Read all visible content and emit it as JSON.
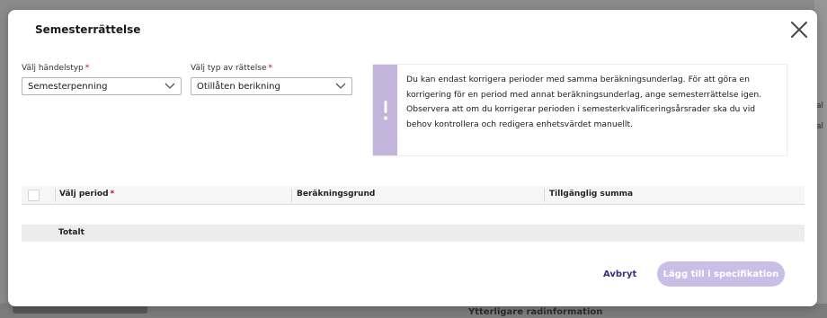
{
  "background": {
    "bottom_text": "Ytterligare radinformation",
    "right_fragments": [
      "al",
      "al"
    ]
  },
  "modal": {
    "title": "Semesterrättelse",
    "close_icon": "close-icon"
  },
  "form": {
    "event_type": {
      "label": "Välj händelstyp",
      "required_mark": "*",
      "value": "Semesterpenning"
    },
    "correction_type": {
      "label": "Välj typ av rättelse",
      "required_mark": "*",
      "value": "Otillåten berikning"
    }
  },
  "info": {
    "icon": "exclamation-icon",
    "accent_color": "#c2b4da",
    "text": "Du kan endast korrigera perioder med samma beräkningsunderlag. För att göra en korrigering för en period med annat beräkningsunderlag, ange semesterrättelse igen. Observera att om du korrigerar perioden i semesterkvalificeringsårsrader ska du vid behov kontrollera och redigera enhetsvärdet manuellt."
  },
  "table": {
    "columns": [
      {
        "label": "Välj period",
        "required_mark": "*"
      },
      {
        "label": "Beräkningsgrund"
      },
      {
        "label": "Tillgänglig summa"
      }
    ],
    "rows": [],
    "total_label": "Totalt"
  },
  "actions": {
    "cancel_label": "Avbryt",
    "add_label": "Lägg till i specifikation",
    "add_color": "#c9bfe6",
    "cancel_color": "#3a2f7a"
  }
}
